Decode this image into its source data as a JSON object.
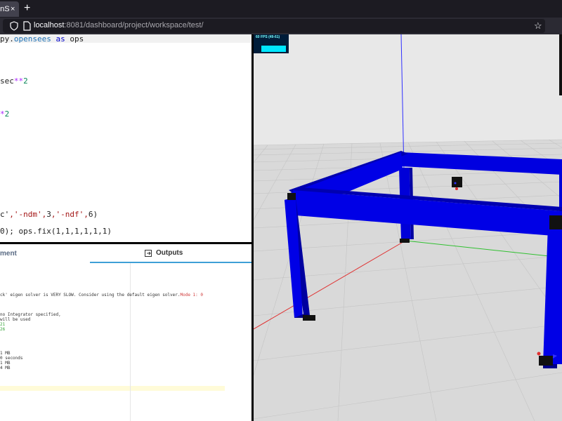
{
  "browser": {
    "tab_title": "enS",
    "tab_close": "×",
    "new_tab": "+",
    "url_host": "localhost",
    "url_path": ":8081/dashboard/project/workspace/test/",
    "bookmark": "☆"
  },
  "editor": {
    "lines": [
      {
        "parts": [
          [
            "py.",
            ""
          ],
          [
            "opensees",
            "attr"
          ],
          [
            " as ",
            "kw"
          ],
          [
            "ops",
            ""
          ]
        ]
      },
      {
        "parts": []
      },
      {
        "parts": []
      },
      {
        "parts": []
      },
      {
        "parts": []
      },
      {
        "parts": [
          [
            "sec",
            ""
          ],
          [
            "**",
            "op"
          ],
          [
            "2",
            "num"
          ]
        ]
      },
      {
        "parts": []
      },
      {
        "parts": []
      },
      {
        "parts": []
      },
      {
        "parts": [
          [
            "*",
            "op"
          ],
          [
            "2",
            "num"
          ]
        ]
      },
      {
        "parts": []
      },
      {
        "parts": []
      },
      {
        "parts": []
      },
      {
        "parts": []
      },
      {
        "parts": []
      },
      {
        "parts": []
      },
      {
        "parts": []
      },
      {
        "parts": []
      },
      {
        "parts": []
      },
      {
        "parts": []
      },
      {
        "parts": []
      },
      {
        "parts": [
          [
            "c'",
            ""
          ],
          [
            ",'-ndm',",
            "str"
          ],
          [
            "3",
            ""
          ],
          [
            ",'-ndf',",
            "str"
          ],
          [
            "6",
            ""
          ],
          [
            ")",
            ""
          ]
        ]
      },
      {
        "parts": []
      },
      {
        "parts": [
          [
            "0); ops.fix(1,1,1,1,1,1)",
            ""
          ]
        ]
      }
    ]
  },
  "panels": {
    "left_tab": "ment",
    "right_tab": "Outputs"
  },
  "output": {
    "lines": [
      {
        "text": "ck' eigen solver is VERY SLOW. Consider using the default eigen solver.",
        "suffix": "Mode 1: 0",
        "cls": ""
      },
      {
        "text": "",
        "cls": ""
      },
      {
        "text": "",
        "cls": ""
      },
      {
        "text": "no Integrator specified,",
        "cls": ""
      },
      {
        "text": "will be used",
        "cls": ""
      },
      {
        "text": "21",
        "cls": "out-green"
      },
      {
        "text": "26",
        "cls": "out-green"
      },
      {
        "text": "",
        "cls": ""
      },
      {
        "text": "",
        "cls": ""
      },
      {
        "text": "",
        "cls": ""
      },
      {
        "text": "1 MB",
        "cls": ""
      },
      {
        "text": "0 seconds",
        "cls": ""
      },
      {
        "text": "1 MB",
        "cls": ""
      },
      {
        "text": "4 MB",
        "cls": ""
      }
    ]
  },
  "viewport": {
    "fps_label": "60 FPS (49-61)",
    "ground_color": "#d8d8d8",
    "frame_color": "#0000cc",
    "sky_color": "#e8e8e8"
  }
}
